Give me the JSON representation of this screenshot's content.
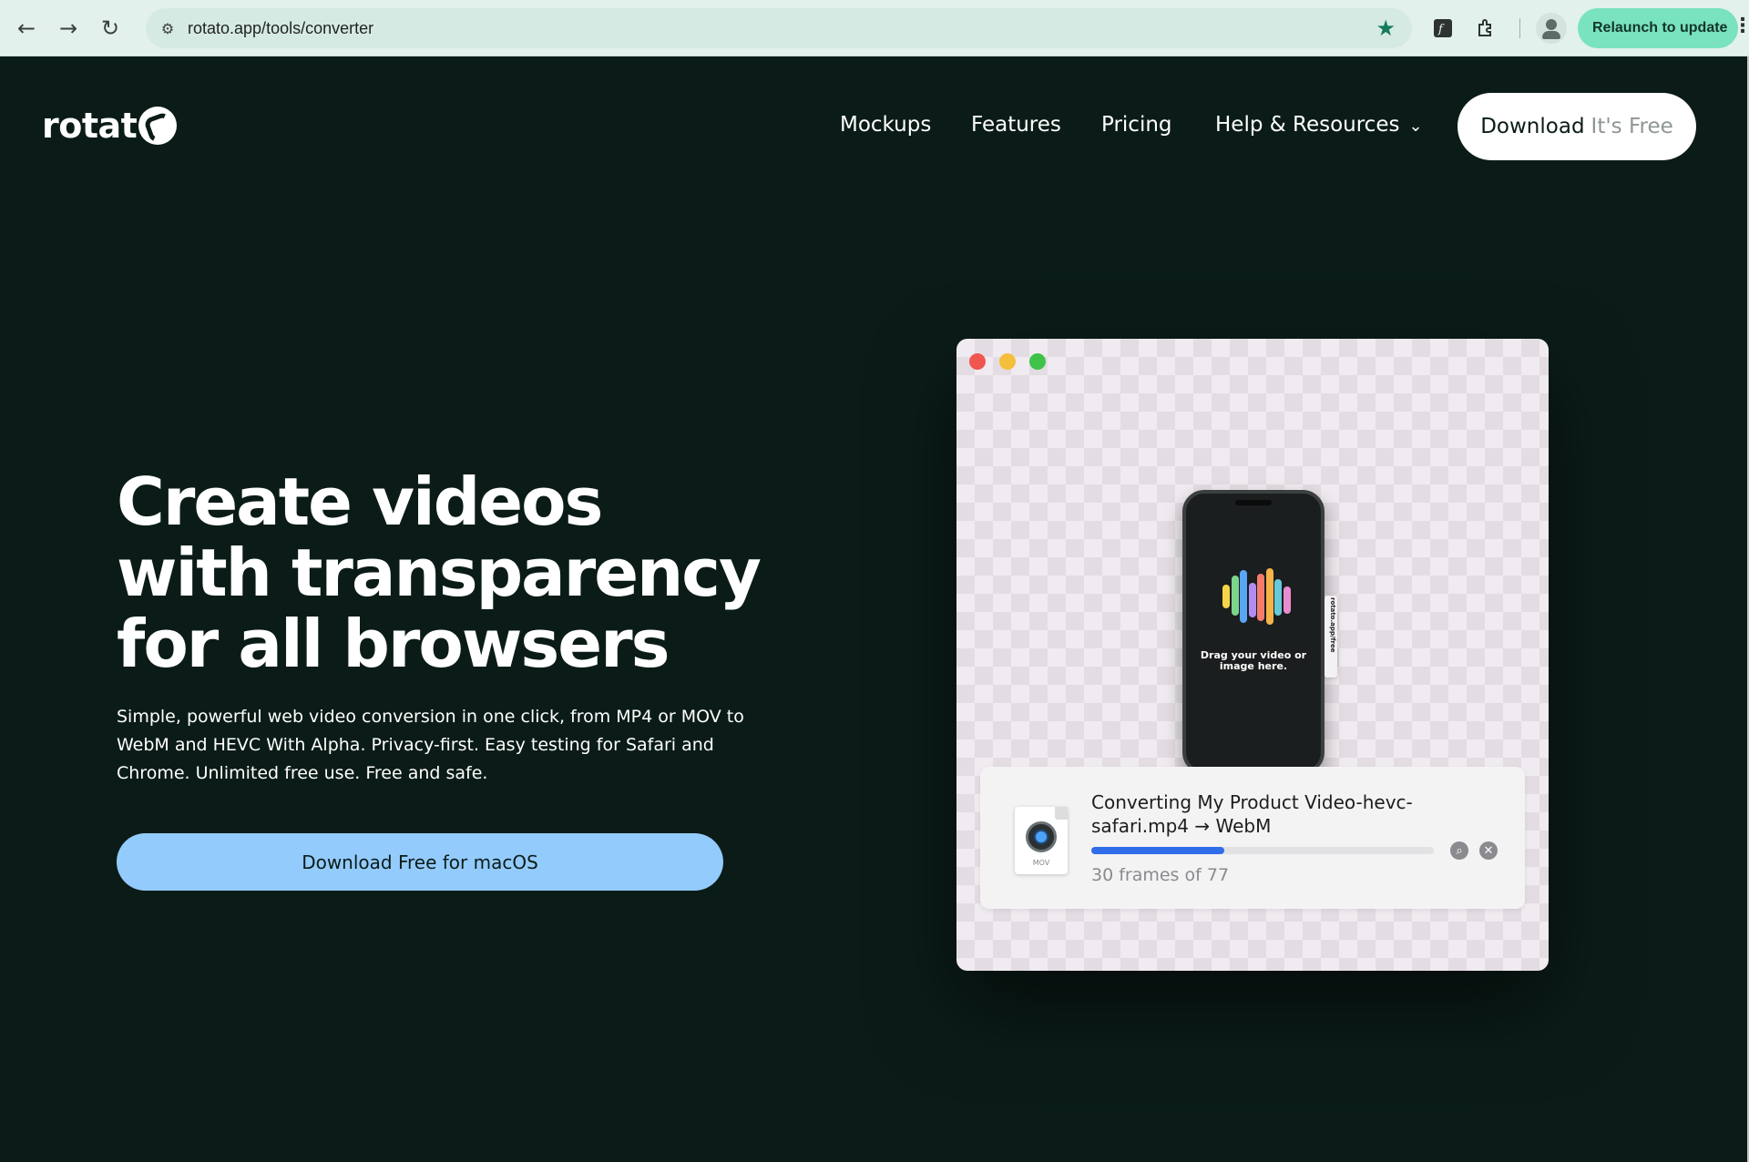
{
  "browser": {
    "url": "rotato.app/tools/converter",
    "relaunch_label": "Relaunch to update",
    "icons": [
      "back-icon",
      "forward-icon",
      "reload-icon",
      "site-info-icon",
      "bookmark-star-icon",
      "extension-font-icon",
      "extensions-puzzle-icon",
      "profile-icon",
      "menu-kebab-icon"
    ]
  },
  "header": {
    "logo_text": "rotat",
    "nav": [
      "Mockups",
      "Features",
      "Pricing",
      "Help & Resources"
    ],
    "download_label": "Download",
    "download_sub": "It's Free"
  },
  "hero": {
    "title_lines": [
      "Create videos",
      "with transparency",
      "for all browsers"
    ],
    "subtitle": "Simple, powerful web video conversion in one click, from MP4 or MOV to WebM and HEVC With Alpha. Privacy-first. Easy testing for Safari and Chrome. Unlimited free use. Free and safe.",
    "cta_label": "Download Free for macOS"
  },
  "mockup": {
    "phone_text": "Drag your video or image here.",
    "phone_side_text": "rotato.app/free",
    "file_ext": "MOV",
    "convert_title": "Converting My Product Video-hevc-safari.mp4 → WebM",
    "frames_done": 30,
    "frames_total": 77,
    "progress_label": "30 frames of 77",
    "bar_colors": [
      "#f5d547",
      "#7cd58b",
      "#5aa6f5",
      "#b28cf2",
      "#f57b6b",
      "#f5b34a",
      "#66c9d9",
      "#e98bd0"
    ]
  },
  "colors": {
    "page_bg": "#0b1c18",
    "cta_bg": "#93cbfc",
    "relaunch_bg": "#79e2bf",
    "progress": "#2f6ee8"
  }
}
